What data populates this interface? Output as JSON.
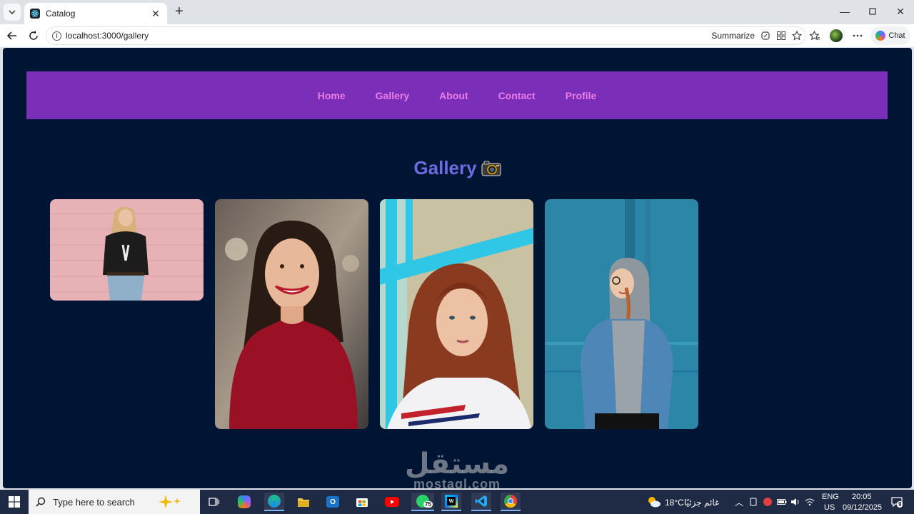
{
  "browser": {
    "tab_title": "Catalog",
    "url": "localhost:3000/gallery",
    "summarize_label": "Summarize",
    "chat_label": "Chat"
  },
  "navbar": {
    "links": [
      "Home",
      "Gallery",
      "About",
      "Contact",
      "Profile"
    ]
  },
  "page": {
    "heading": "Gallery",
    "heading_icon": "camera-icon"
  },
  "gallery": {
    "photos": [
      {
        "name": "woman-pink-wall",
        "palette": [
          "#e8b4b8",
          "#d99aa0"
        ]
      },
      {
        "name": "woman-red-top-smiling",
        "palette": [
          "#8a2330",
          "#5c4a44"
        ]
      },
      {
        "name": "woman-auburn-hair-blue-window",
        "palette": [
          "#3fc7e3",
          "#c9c2a0"
        ]
      },
      {
        "name": "woman-denim-jacket-blue-wall",
        "palette": [
          "#2e86a8",
          "#1d6885"
        ]
      }
    ]
  },
  "watermark": {
    "arabic": "مستقل",
    "latin": "mostaql.com"
  },
  "taskbar": {
    "search_placeholder": "Type here to search",
    "whatsapp_badge": "75",
    "weather": "18°C",
    "weather_desc": "غائم جزئيًا",
    "language": "ENG",
    "region": "US",
    "time": "20:05",
    "date": "09/12/2025",
    "notification_count": "9"
  }
}
